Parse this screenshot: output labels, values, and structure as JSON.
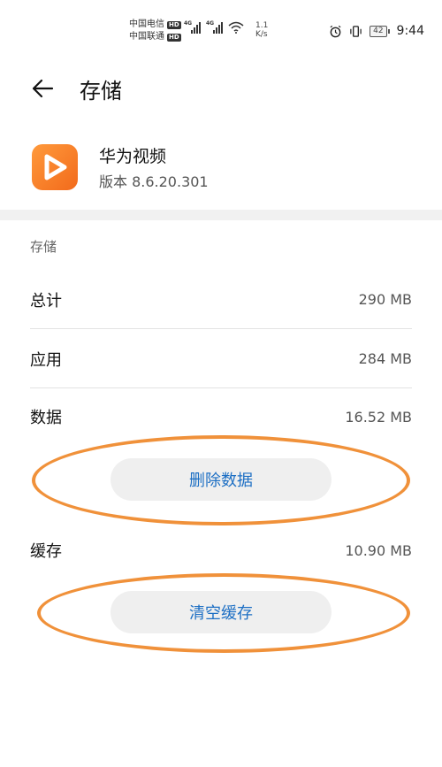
{
  "status_bar": {
    "carrier1": "中国电信",
    "carrier2": "中国联通",
    "hd": "HD",
    "network1": "4G",
    "network2": "4G",
    "speed_value": "1.1",
    "speed_unit": "K/s",
    "battery": "42",
    "time": "9:44"
  },
  "header": {
    "title": "存储"
  },
  "app": {
    "name": "华为视频",
    "version": "版本 8.6.20.301"
  },
  "storage": {
    "section_title": "存储",
    "rows": [
      {
        "label": "总计",
        "value": "290 MB"
      },
      {
        "label": "应用",
        "value": "284 MB"
      },
      {
        "label": "数据",
        "value": "16.52 MB"
      }
    ],
    "clear_data_label": "删除数据",
    "cache_label": "缓存",
    "cache_value": "10.90 MB",
    "clear_cache_label": "清空缓存"
  },
  "colors": {
    "accent": "#1d6fc4",
    "app_icon": "#f26a1b",
    "annotation": "#f0913a"
  }
}
